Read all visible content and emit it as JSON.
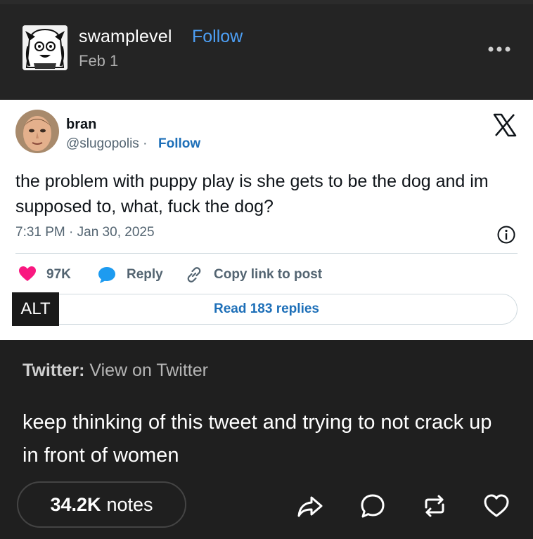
{
  "post": {
    "username": "swamplevel",
    "follow_label": "Follow",
    "date": "Feb 1",
    "more_icon": "more-icon"
  },
  "tweet": {
    "display_name": "bran",
    "handle": "@slugopolis ·",
    "follow_label": "Follow",
    "text": "the problem with puppy play is she gets to be the dog and im supposed to, what, fuck the dog?",
    "timestamp": "7:31 PM · Jan 30, 2025",
    "likes": "97K",
    "reply_label": "Reply",
    "copy_link_label": "Copy link to post",
    "read_replies_label": "Read 183 replies",
    "alt_label": "ALT"
  },
  "source": {
    "prefix": "Twitter:",
    "text": "View on Twitter"
  },
  "body_text": "keep thinking of this tweet and trying to not crack up in front of women",
  "footer": {
    "notes_count": "34.2K",
    "notes_label": "notes"
  },
  "colors": {
    "background": "#1f1f1f",
    "follow_blue": "#4d9ff5",
    "tweet_link_blue": "#1d6fb8",
    "heart_red": "#f91880",
    "reply_blue": "#1d9bf0"
  }
}
